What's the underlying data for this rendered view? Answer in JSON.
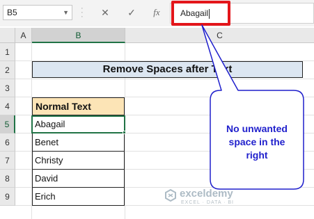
{
  "formula_bar": {
    "name_box": "B5",
    "cancel_icon": "✕",
    "enter_icon": "✓",
    "fx_label": "fx",
    "content": "Abagail"
  },
  "columns": [
    "A",
    "B",
    "C"
  ],
  "rows": [
    "1",
    "2",
    "3",
    "4",
    "5",
    "6",
    "7",
    "8",
    "9"
  ],
  "title": "Remove Spaces after Text",
  "table": {
    "header": "Normal Text",
    "values": [
      "Abagail",
      "Benet",
      "Christy",
      "David",
      "Erich"
    ]
  },
  "callout": {
    "line1": "No unwanted",
    "line2": "space in the",
    "line3": "right"
  },
  "watermark": {
    "name": "exceldemy",
    "tag": "EXCEL · DATA · BI"
  },
  "colors": {
    "accent": "#217346",
    "highlight": "#e3151a",
    "callout_border": "#1f1fcc",
    "header_fill": "#fce4b6",
    "title_fill": "#dce6f1"
  }
}
